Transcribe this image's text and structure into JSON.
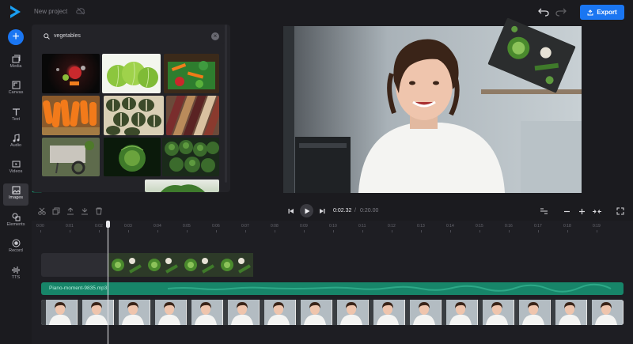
{
  "app": {
    "project_title": "New project",
    "export_label": "Export",
    "brand_color": "#1a76f2"
  },
  "sidebar": {
    "items": [
      {
        "label": "Media",
        "icon": "media-icon"
      },
      {
        "label": "Canvas",
        "icon": "canvas-icon"
      },
      {
        "label": "Text",
        "icon": "text-icon"
      },
      {
        "label": "Audio",
        "icon": "music-note-icon"
      },
      {
        "label": "Videos",
        "icon": "video-icon"
      },
      {
        "label": "Images",
        "icon": "image-icon",
        "active": true
      },
      {
        "label": "Elements",
        "icon": "shapes-icon"
      },
      {
        "label": "Record",
        "icon": "record-icon"
      },
      {
        "label": "TTS",
        "icon": "waveform-icon"
      }
    ]
  },
  "search": {
    "value": "vegetables"
  },
  "playback": {
    "current_time": "0:02.32",
    "separator": "/",
    "total_time": "0:20.00"
  },
  "timeline": {
    "ruler": [
      "0:00",
      "0:01",
      "0:02",
      "0:03",
      "0:04",
      "0:05",
      "0:06",
      "0:07",
      "0:08",
      "0:09",
      "0:10",
      "0:11",
      "0:12",
      "0:13",
      "0:14",
      "0:15",
      "0:16",
      "0:17",
      "0:18",
      "0:19"
    ],
    "audio_clip_name": "Piano-moment-9835.mp3",
    "audio_color": "#178569"
  }
}
